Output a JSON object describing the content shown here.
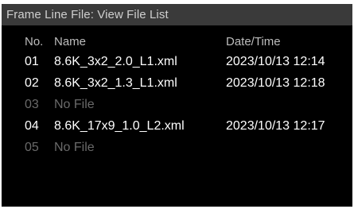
{
  "title": "Frame Line File: View File List",
  "headers": {
    "no": "No.",
    "name": "Name",
    "datetime": "Date/Time"
  },
  "files": [
    {
      "no": "01",
      "name": "8.6K_3x2_2.0_L1.xml",
      "datetime": "2023/10/13 12:14",
      "empty": false
    },
    {
      "no": "02",
      "name": "8.6K_3x2_1.3_L1.xml",
      "datetime": "2023/10/13 12:18",
      "empty": false
    },
    {
      "no": "03",
      "name": "No File",
      "datetime": "",
      "empty": true
    },
    {
      "no": "04",
      "name": "8.6K_17x9_1.0_L2.xml",
      "datetime": "2023/10/13 12:17",
      "empty": false
    },
    {
      "no": "05",
      "name": "No File",
      "datetime": "",
      "empty": true
    }
  ],
  "colors": {
    "background": "#000000",
    "title_bar": "#3a3a3a",
    "text": "#ffffff",
    "empty_text": "#6a6a6a"
  }
}
